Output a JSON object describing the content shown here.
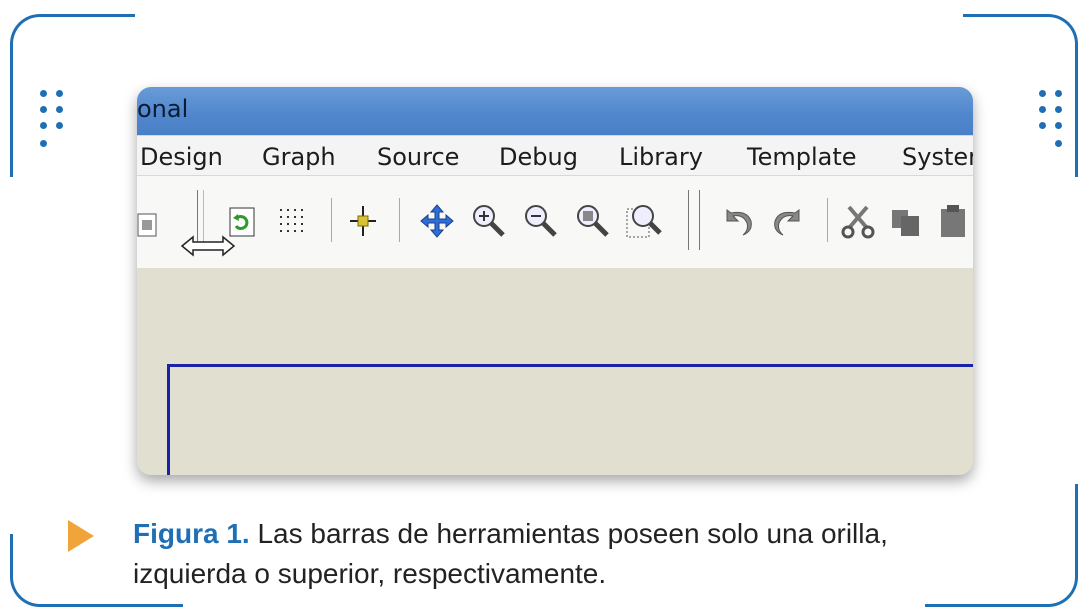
{
  "window": {
    "title_fragment": "onal"
  },
  "menu": [
    "Design",
    "Graph",
    "Source",
    "Debug",
    "Library",
    "Template",
    "Syster"
  ],
  "toolbar_icons": [
    "new-sheet-icon",
    "resize-cursor-icon",
    "refresh-icon",
    "grid-icon",
    "origin-icon",
    "pan-icon",
    "zoom-in-icon",
    "zoom-out-icon",
    "zoom-all-icon",
    "zoom-area-icon",
    "undo-icon",
    "redo-icon",
    "cut-icon",
    "copy-icon",
    "paste-icon"
  ],
  "caption": {
    "label": "Figura 1.",
    "text": " Las barras de herramientas poseen solo una orilla,",
    "text2": "izquierda o superior, respectivamente."
  },
  "colors": {
    "accent": "#1f6fb5",
    "arrow": "#f0a43a",
    "titlebar": "#4f86cc",
    "canvas": "#e1dfd0"
  }
}
